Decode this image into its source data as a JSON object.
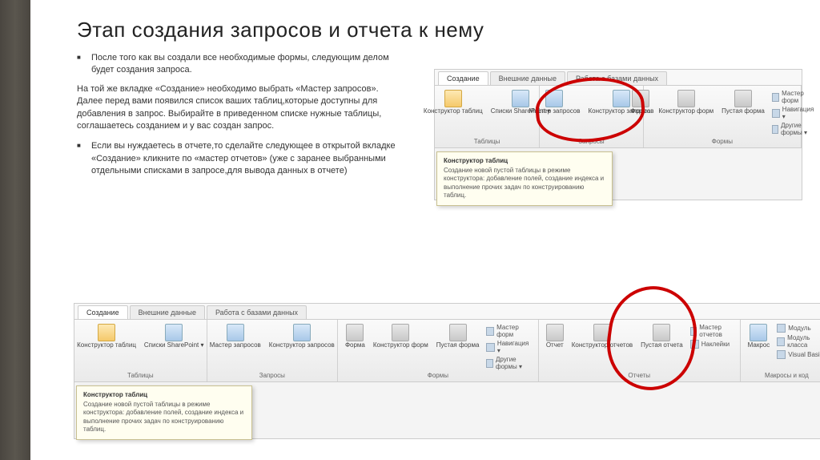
{
  "title": "Этап создания запросов и отчета к нему",
  "bullet1": "После того как вы создали все необходимые формы, следующим делом будет создания запроса.",
  "para1": "На той же вкладке «Создание» необходимо выбрать «Мастер запросов». Далее перед вами появился список ваших таблиц,которые доступны для добавления в запрос. Выбирайте в приведенном списке нужные таблицы, соглашаетесь созданием и у вас создан запрос.",
  "bullet2": "Если вы нуждаетесь в отчете,то сделайте следующее в открытой вкладке «Создание» кликните по «мастер отчетов» (уже с заранее выбранными отдельными списками в запросе,для вывода данных в отчете)",
  "tabs": {
    "create": "Создание",
    "external": "Внешние данные",
    "dbwork": "Работа с базами данных"
  },
  "groups": {
    "tables": "Таблицы",
    "queries": "Запросы",
    "forms": "Формы",
    "reports": "Отчеты",
    "macros": "Макросы и код"
  },
  "btns": {
    "konstTabl": "Конструктор таблиц",
    "spiski": "Списки SharePoint ▾",
    "masterZap": "Мастер запросов",
    "konstZap": "Конструктор запросов",
    "forma": "Форма",
    "konstForm": "Конструктор форм",
    "pustForm": "Пустая форма",
    "masterForm": "Мастер форм",
    "navig": "Навигация ▾",
    "drugForm": "Другие формы ▾",
    "otchet": "Отчет",
    "konstOtch": "Конструктор отчетов",
    "pustOtch": "Пустая отчета",
    "masterOtch": "Мастер отчетов",
    "nakleiki": "Наклейки",
    "makros": "Макрос",
    "modul": "Модуль",
    "modulK": "Модуль класса",
    "vb": "Visual Basic"
  },
  "tooltip": {
    "title": "Конструктор таблиц",
    "body": "Создание новой пустой таблицы в режиме конструктора: добавление полей, создание индекса и выполнение прочих задач по конструированию таблиц."
  }
}
